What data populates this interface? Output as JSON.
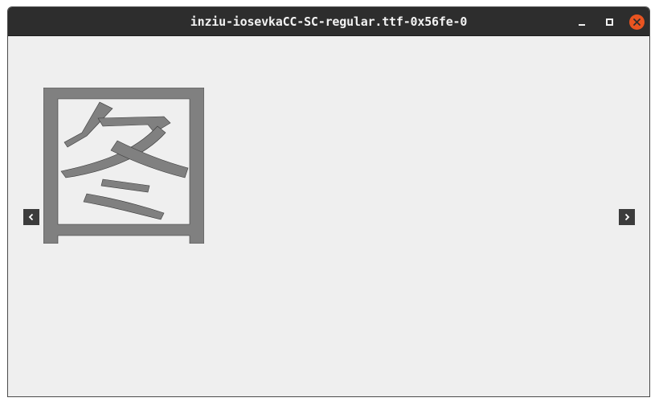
{
  "window": {
    "title": "inziu-iosevkaCC-SC-regular.ttf-0x56fe-0"
  },
  "viewer": {
    "glyph_icon": "glyph-0x56fe-icon"
  },
  "navigation": {
    "prev_icon": "chevron-left-icon",
    "next_icon": "chevron-right-icon"
  },
  "colors": {
    "titlebar": "#2d2d2d",
    "close_button": "#e95420",
    "background": "#efefef",
    "glyph_fill": "#808080"
  }
}
